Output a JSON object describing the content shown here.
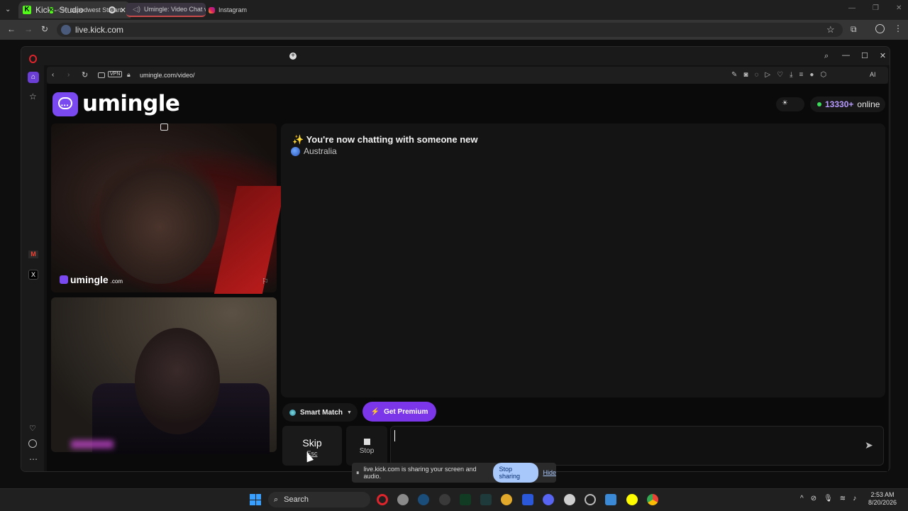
{
  "chrome": {
    "tab_title": "Kick - Studio",
    "url": "live.kick.com"
  },
  "opera": {
    "tabs": [
      {
        "label": "capodwest Stream - W"
      },
      {
        "label": "Umingle: Video Chat v"
      },
      {
        "label": "Instagram"
      }
    ],
    "url": "umingle.com/video/",
    "vpn_label": "VPN",
    "ai_label": "AI"
  },
  "umingle": {
    "logo_text": "umingle",
    "online_count": "13330+",
    "online_label": "online",
    "watermark_brand": "umingle",
    "watermark_domain": ".com",
    "chat_title": "You're now chatting with someone new",
    "chat_location": "Australia",
    "smart_match_label": "Smart Match",
    "premium_label": "Get Premium",
    "skip_label": "Skip",
    "skip_key": "Esc",
    "stop_label": "Stop"
  },
  "share_bar": {
    "message": "live.kick.com is sharing your screen and audio.",
    "stop_label": "Stop sharing",
    "hide_label": "Hide"
  },
  "taskbar": {
    "search_label": "Search",
    "time": "2:53 AM",
    "date": "8/20/2026"
  },
  "colors": {
    "accent": "#7a36e8",
    "online_dot": "#3ddc5c",
    "kick_green": "#53fc18"
  }
}
